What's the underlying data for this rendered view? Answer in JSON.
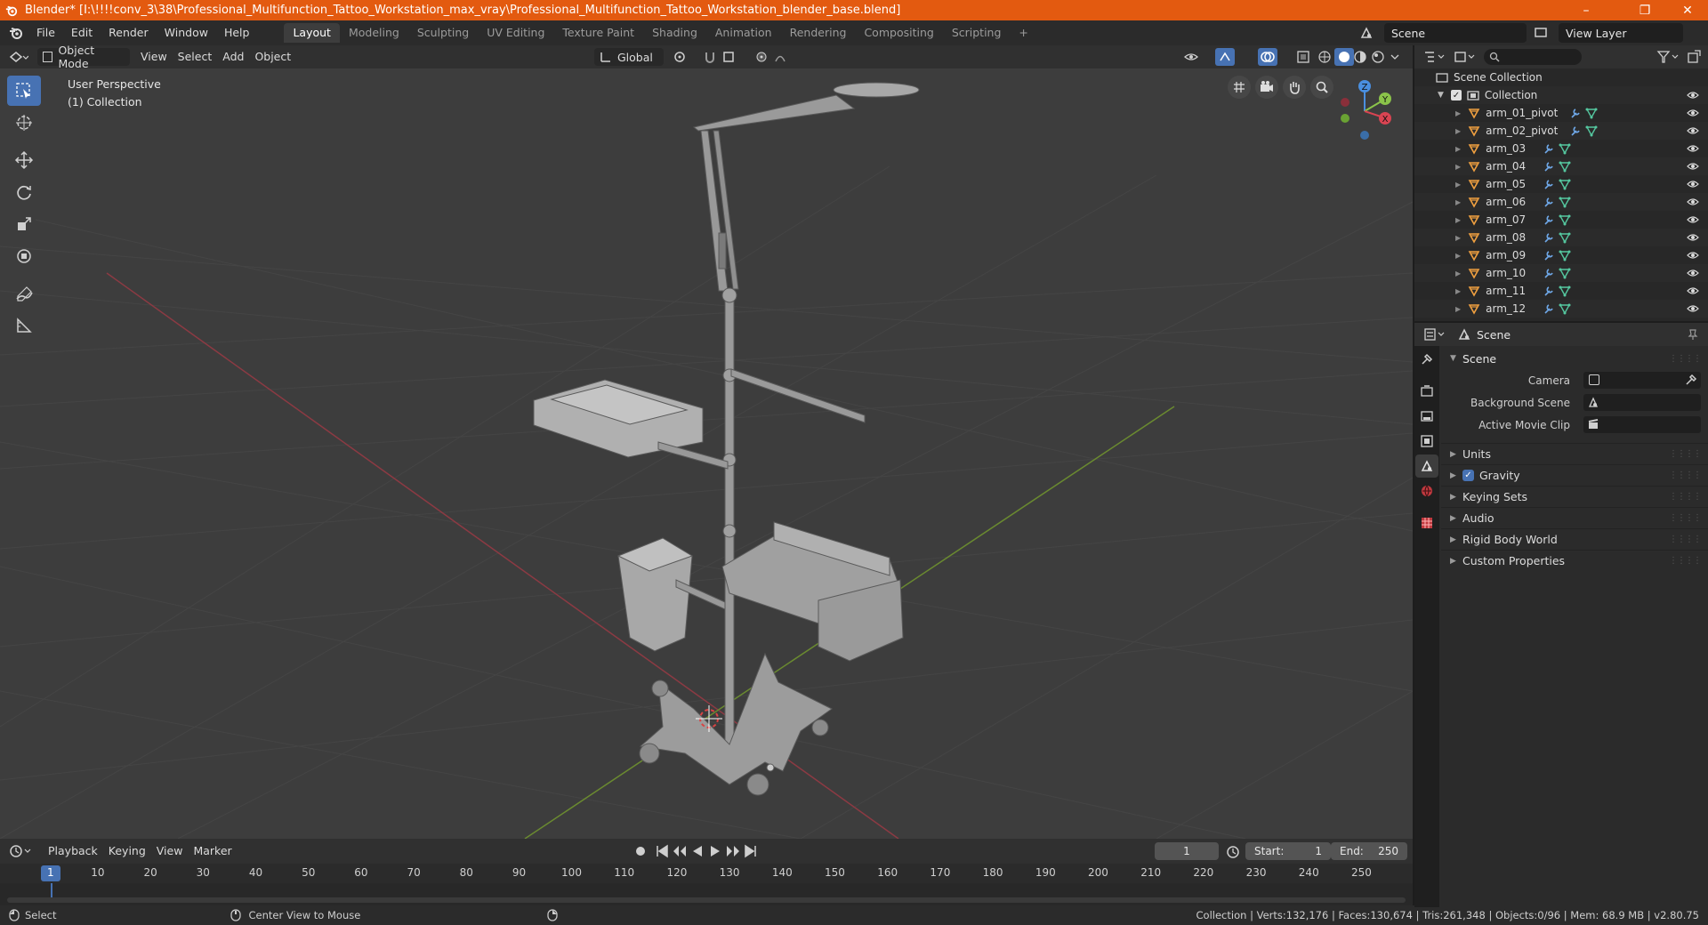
{
  "window": {
    "title": "Blender* [I:\\!!!!conv_3\\38\\Professional_Multifunction_Tattoo_Workstation_max_vray\\Professional_Multifunction_Tattoo_Workstation_blender_base.blend]",
    "minimize": "–",
    "restore": "❐",
    "close": "✕"
  },
  "menu": {
    "items": [
      "File",
      "Edit",
      "Render",
      "Window",
      "Help"
    ]
  },
  "workspaces": {
    "tabs": [
      "Layout",
      "Modeling",
      "Sculpting",
      "UV Editing",
      "Texture Paint",
      "Shading",
      "Animation",
      "Rendering",
      "Compositing",
      "Scripting"
    ],
    "active": "Layout",
    "add": "+"
  },
  "scene_selector": {
    "value": "Scene"
  },
  "view_layer_selector": {
    "value": "View Layer"
  },
  "viewport_header": {
    "mode": "Object Mode",
    "menus": [
      "View",
      "Select",
      "Add",
      "Object"
    ],
    "transform_orientation": "Global"
  },
  "viewport": {
    "perspective": "User Perspective",
    "collection": "(1) Collection",
    "gizmo_axes": {
      "x": "X",
      "y": "Y",
      "z": "Z"
    }
  },
  "outliner": {
    "root": "Scene Collection",
    "collection": "Collection",
    "items": [
      "arm_01_pivot",
      "arm_02_pivot",
      "arm_03",
      "arm_04",
      "arm_05",
      "arm_06",
      "arm_07",
      "arm_08",
      "arm_09",
      "arm_10",
      "arm_11",
      "arm_12"
    ]
  },
  "properties": {
    "context": "Scene",
    "panel": "Scene",
    "fields": [
      {
        "label": "Camera",
        "value": ""
      },
      {
        "label": "Background Scene",
        "value": ""
      },
      {
        "label": "Active Movie Clip",
        "value": ""
      }
    ],
    "subpanels": [
      "Units",
      "Gravity",
      "Keying Sets",
      "Audio",
      "Rigid Body World",
      "Custom Properties"
    ],
    "gravity_checked": true
  },
  "timeline": {
    "menus": [
      "Playback",
      "Keying",
      "View",
      "Marker"
    ],
    "current_frame": "1",
    "start_label": "Start:",
    "start": "1",
    "end_label": "End:",
    "end": "250",
    "ticks": [
      "1",
      "10",
      "20",
      "30",
      "40",
      "50",
      "60",
      "70",
      "80",
      "90",
      "100",
      "110",
      "120",
      "130",
      "140",
      "150",
      "160",
      "170",
      "180",
      "190",
      "200",
      "210",
      "220",
      "230",
      "240",
      "250"
    ]
  },
  "statusbar": {
    "left_action": "Select",
    "middle_action": "Center View to Mouse",
    "stats": "Collection | Verts:132,176 | Faces:130,674 | Tris:261,348 | Objects:0/96 | Mem: 68.9 MB | v2.80.75"
  },
  "colors": {
    "title_bar": "#e35a10",
    "accent": "#4772b3",
    "viewport_bg": "#3d3d3d",
    "x_axis": "#d94452",
    "y_axis": "#8bc34a",
    "z_axis": "#4a8fe0"
  }
}
